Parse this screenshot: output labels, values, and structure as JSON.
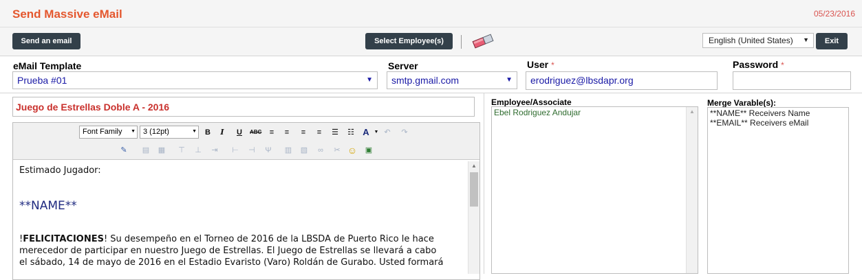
{
  "header": {
    "title": "Send Massive eMail",
    "date": "05/23/2016"
  },
  "toolbar": {
    "send_label": "Send an email",
    "select_label": "Select Employee(s)",
    "language": "English (United States)",
    "exit_label": "Exit"
  },
  "form": {
    "template_label": "eMail Template",
    "template_value": "Prueba #01",
    "server_label": "Server",
    "server_value": "smtp.gmail.com",
    "user_label": "User",
    "user_value": "erodriguez@lbsdapr.org",
    "password_label": "Password",
    "required_mark": "*"
  },
  "subject": "Juego de Estrellas Doble A - 2016",
  "editor": {
    "font_family": "Font Family",
    "font_size": "3 (12pt)",
    "greeting": "Estimado Jugador:",
    "name_tag": "**NAME**",
    "para_bold": "FELICITACIONES",
    "para_prefix": "!",
    "para_line1": "!  Su desempeño en el Torneo de 2016 de la LBSDA de Puerto Rico le hace",
    "para_line2": "merecedor de participar en nuestro Juego de Estrellas.  El Juego de Estrellas se llevará a cabo",
    "para_line3": "el sábado, 14 de mayo de 2016 en el Estadio Evaristo (Varo) Roldán de Gurabo.  Usted formará"
  },
  "employees": {
    "label": "Employee/Associate",
    "items": [
      "Ebel Rodriguez Andujar"
    ]
  },
  "merge": {
    "label": "Merge Varable(s):",
    "items": [
      "**NAME** Receivers Name",
      "**EMAIL** Receivers eMail"
    ]
  },
  "colors": {
    "title": "#e4572e",
    "dark_button": "#33404a",
    "subject": "#c9302c",
    "link_value": "#1a1aa6"
  }
}
